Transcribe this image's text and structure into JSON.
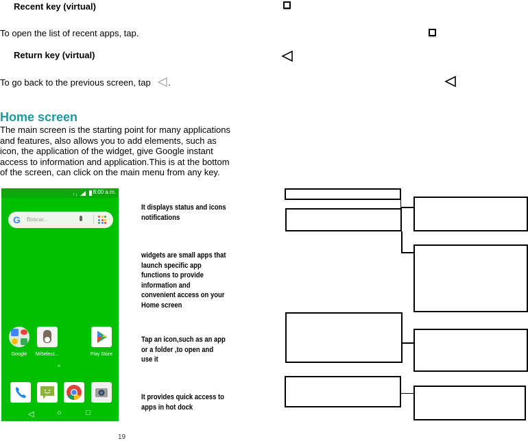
{
  "recent_key": {
    "heading": "Recent key (virtual)",
    "description": "To open the list of recent apps, tap.",
    "icon": "square-recent-icon"
  },
  "return_key": {
    "heading": "Return key (virtual)",
    "description": "To go back to the previous screen, tap",
    "description_end": ".",
    "icon": "triangle-back-icon"
  },
  "home_screen": {
    "title": "Home screen",
    "paragraph_lines": [
      "The main screen is the starting point for many applications",
      "and features, also allows you to add elements, such as",
      "icon, the application of the widget, give Google instant",
      "access to information and application.This is at the bottom",
      "of the screen, can click on the main menu from any key."
    ]
  },
  "phone": {
    "status_time": "8:00 a.m.",
    "search_placeholder": "Buscar...",
    "google_letter": "G",
    "apps": [
      {
        "label": "Google",
        "icon": "google-folder-icon"
      },
      {
        "label": "MiSelecc...",
        "icon": "miseleccion-app-icon"
      },
      {
        "label": "Play Store",
        "icon": "play-store-icon"
      }
    ],
    "drawer_arrow": "^",
    "dock": [
      {
        "icon": "phone-icon"
      },
      {
        "icon": "messaging-icon"
      },
      {
        "icon": "chrome-icon"
      },
      {
        "icon": "camera-icon"
      }
    ],
    "nav": {
      "back": "◁",
      "home": "○",
      "recent": "□"
    },
    "colors": {
      "background": "#00bf00",
      "statusbar": "#0aa80a"
    }
  },
  "callouts": [
    {
      "lines": [
        "It displays status and icons",
        "notifications"
      ]
    },
    {
      "lines": [
        "widgets are small apps that",
        "launch specific app",
        "functions to provide",
        "information and",
        "convenient access on your",
        "Home screen"
      ]
    },
    {
      "lines": [
        "Tap an icon,such as an app",
        "or a folder ,to open and",
        "use it"
      ]
    },
    {
      "lines": [
        "It provides quick access to",
        "apps in hot dock"
      ]
    }
  ],
  "page_number": "19",
  "colors": {
    "section_title": "#1a9aa0"
  }
}
